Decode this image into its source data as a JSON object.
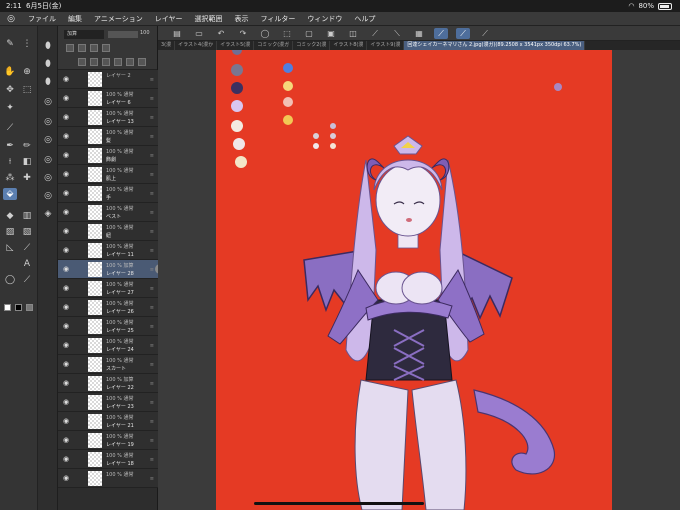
{
  "status": {
    "time": "2:11",
    "date": "6月5日(金)",
    "battery": "80%"
  },
  "menu": [
    "ファイル",
    "編集",
    "アニメーション",
    "レイヤー",
    "選択範囲",
    "表示",
    "フィルター",
    "ウィンドウ",
    "ヘルプ"
  ],
  "tabs": [
    {
      "label": "3(漫",
      "active": false
    },
    {
      "label": "イラスト4(漫か",
      "active": false
    },
    {
      "label": "イラスト5(漫",
      "active": false
    },
    {
      "label": "コミック(漫ガ",
      "active": false
    },
    {
      "label": "コミック2(漫",
      "active": false
    },
    {
      "label": "イラスト8(漫",
      "active": false
    },
    {
      "label": "イラスト9(漫",
      "active": false
    },
    {
      "label": "回達シェイカーネマリさん 2.jpg(漫ガ)(89.2508 x 3541px 350dpi 63.7%)",
      "active": true
    }
  ],
  "layer_header": {
    "blend": "加算",
    "opacity": "100"
  },
  "layers": [
    {
      "top": "レイヤー 2",
      "bottom": "",
      "selected": false
    },
    {
      "top": "100 % 通常",
      "bottom": "レイヤー 6",
      "selected": false
    },
    {
      "top": "100 % 通常",
      "bottom": "レイヤー 13",
      "selected": false
    },
    {
      "top": "100 % 通常",
      "bottom": "髪",
      "selected": false
    },
    {
      "top": "100 % 通常",
      "bottom": "飾劇",
      "selected": false
    },
    {
      "top": "100 % 通常",
      "bottom": "肌上",
      "selected": false
    },
    {
      "top": "100 % 通常",
      "bottom": "手",
      "selected": false
    },
    {
      "top": "100 % 通常",
      "bottom": "ベスト",
      "selected": false
    },
    {
      "top": "100 % 通常",
      "bottom": "紐",
      "selected": false
    },
    {
      "top": "100 % 通常",
      "bottom": "レイヤー 11",
      "selected": false
    },
    {
      "top": "100 % 加算",
      "bottom": "レイヤー 28",
      "selected": true
    },
    {
      "top": "100 % 通常",
      "bottom": "レイヤー 27",
      "selected": false
    },
    {
      "top": "100 % 通常",
      "bottom": "レイヤー 26",
      "selected": false
    },
    {
      "top": "100 % 通常",
      "bottom": "レイヤー 25",
      "selected": false
    },
    {
      "top": "100 % 通常",
      "bottom": "レイヤー 24",
      "selected": false
    },
    {
      "top": "100 % 通常",
      "bottom": "スカート",
      "selected": false
    },
    {
      "top": "100 % 加算",
      "bottom": "レイヤー 22",
      "selected": false
    },
    {
      "top": "100 % 通常",
      "bottom": "レイヤー 23",
      "selected": false
    },
    {
      "top": "100 % 通常",
      "bottom": "レイヤー 21",
      "selected": false
    },
    {
      "top": "100 % 通常",
      "bottom": "レイヤー 19",
      "selected": false
    },
    {
      "top": "100 % 通常",
      "bottom": "レイヤー 18",
      "selected": false
    },
    {
      "top": "100 % 通常",
      "bottom": "",
      "selected": false
    }
  ],
  "colors": {
    "canvas": "#e53a24",
    "accent": "#5b7fb0",
    "panel": "#2d2d2d"
  }
}
